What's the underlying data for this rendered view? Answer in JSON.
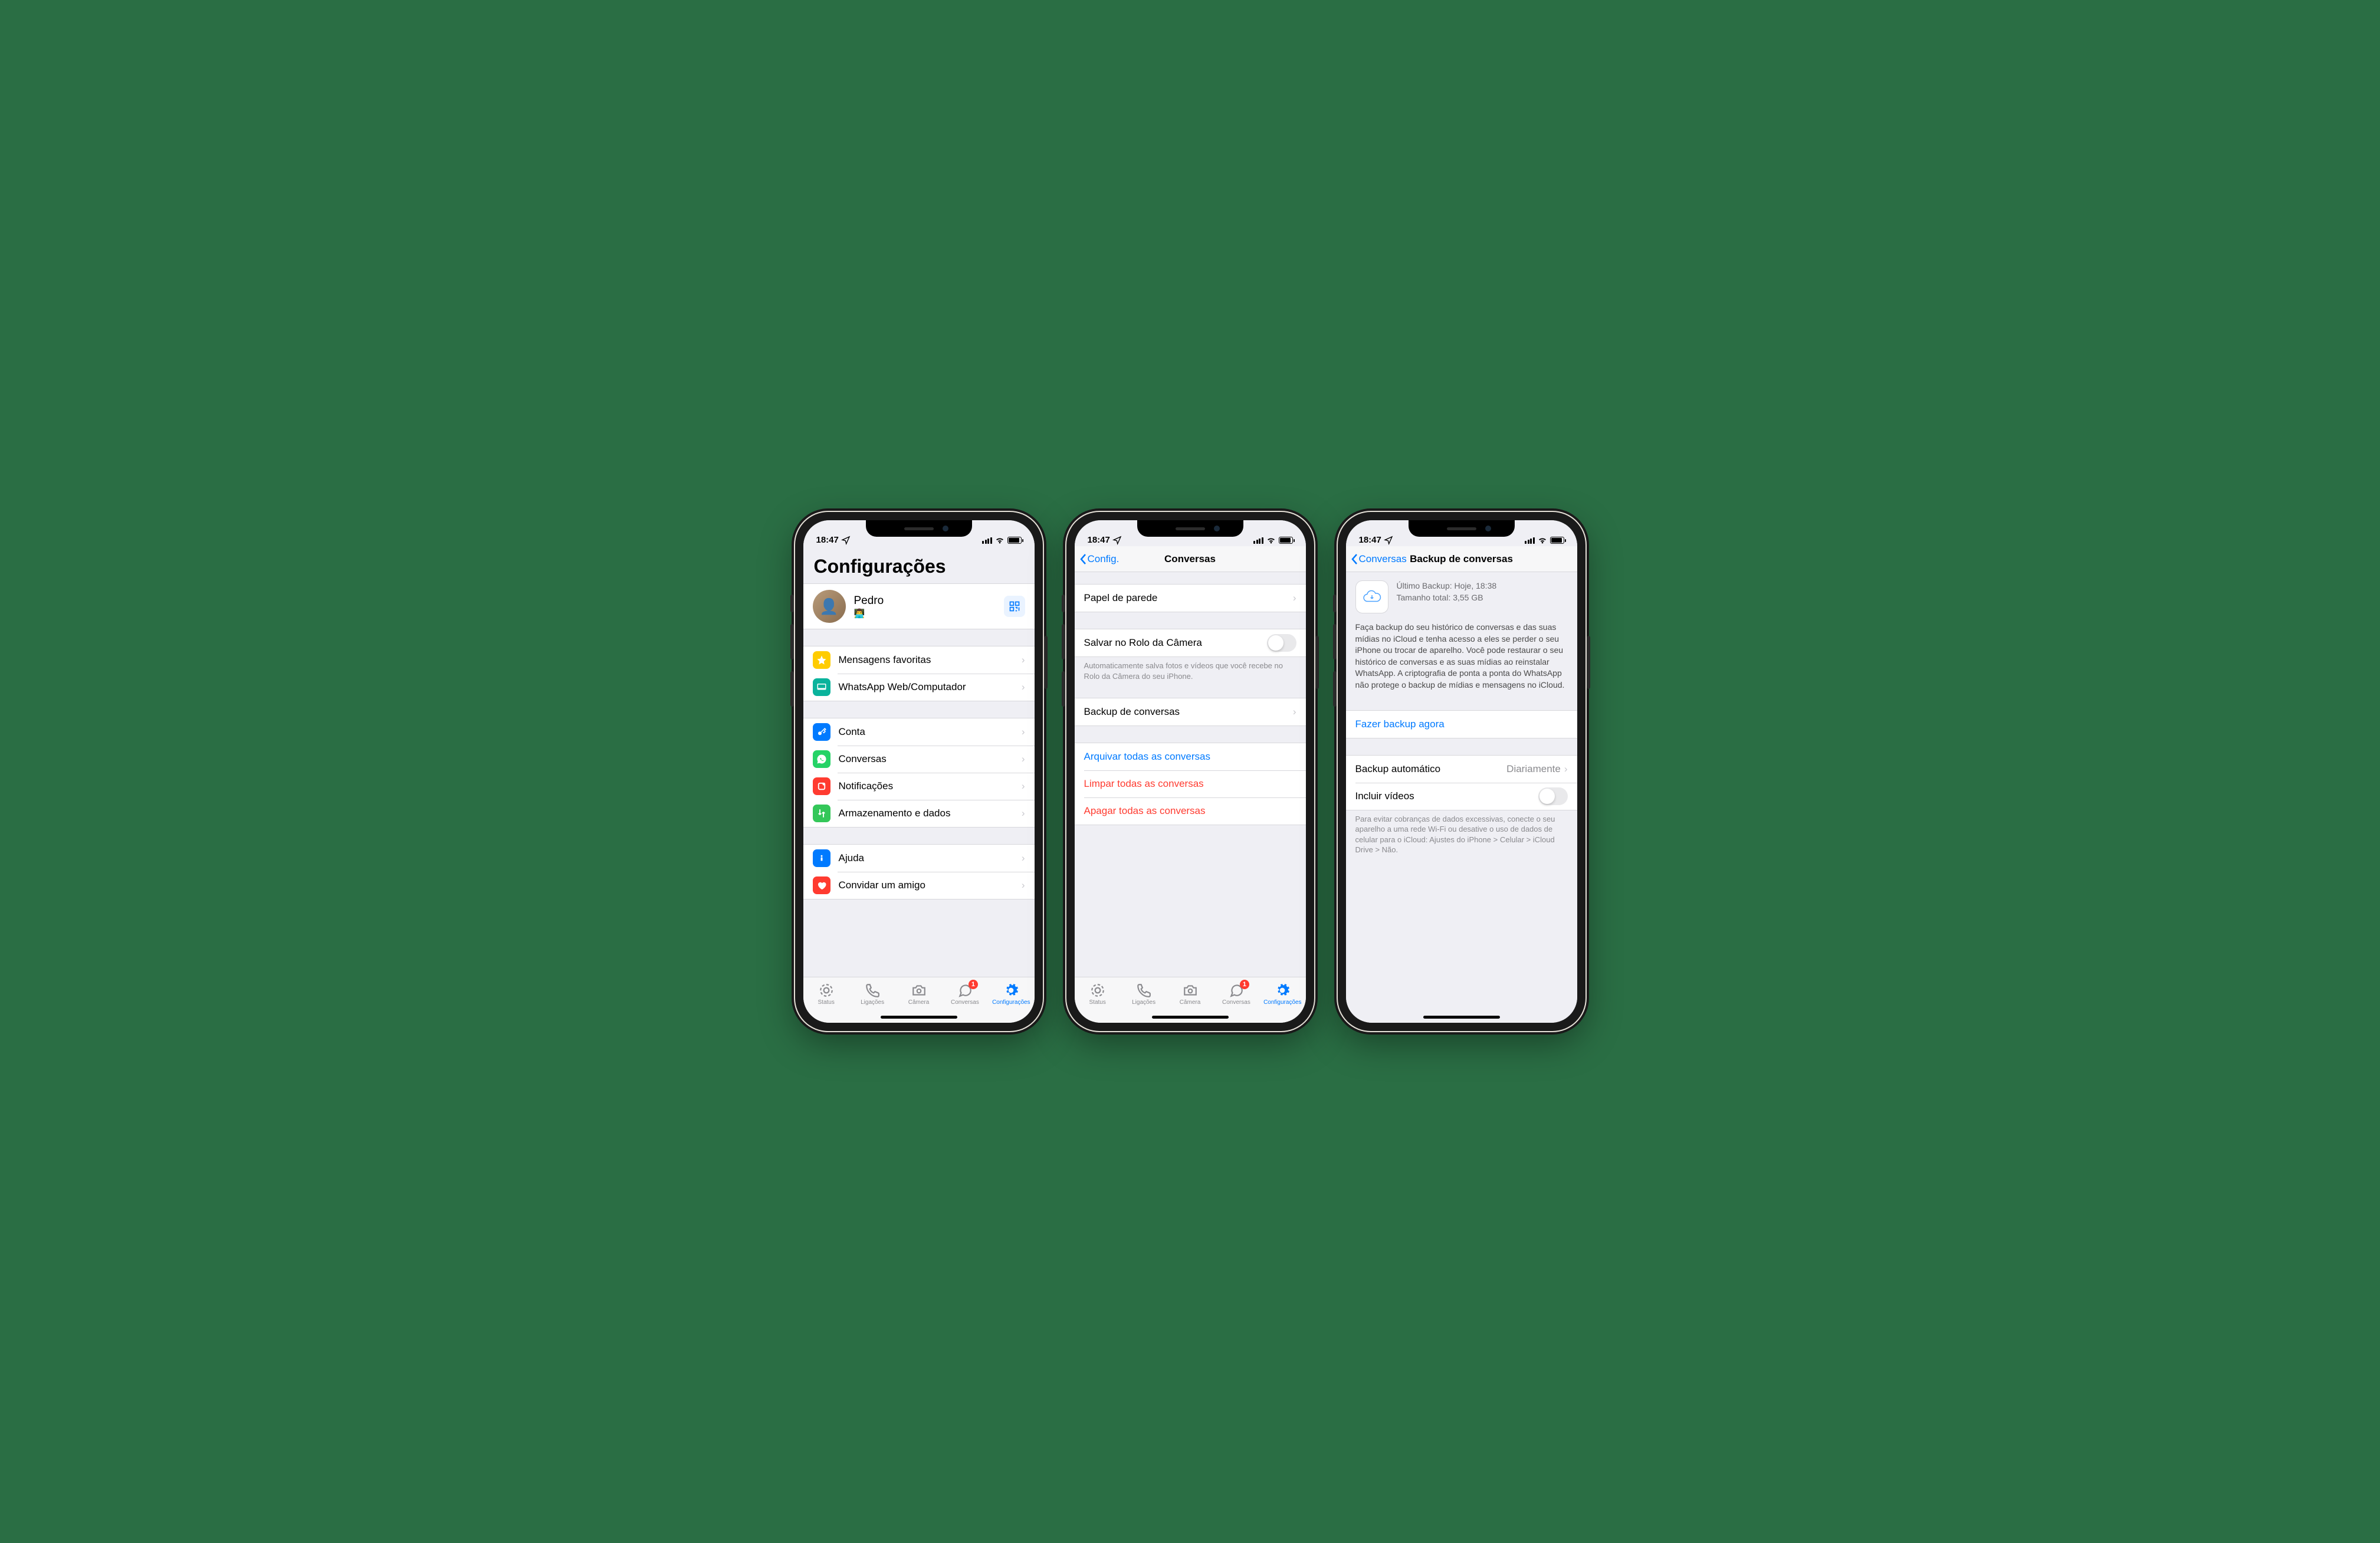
{
  "statusbar": {
    "time": "18:47"
  },
  "tabs": {
    "status": "Status",
    "calls": "Ligações",
    "camera": "Câmera",
    "chats": "Conversas",
    "settings": "Configurações",
    "chats_badge": "1"
  },
  "screen1": {
    "title": "Configurações",
    "profile": {
      "name": "Pedro",
      "status": "👨‍💻"
    },
    "items": {
      "starred": "Mensagens favoritas",
      "web": "WhatsApp Web/Computador",
      "account": "Conta",
      "chats": "Conversas",
      "notifications": "Notificações",
      "storage": "Armazenamento e dados",
      "help": "Ajuda",
      "invite": "Convidar um amigo"
    }
  },
  "screen2": {
    "back": "Config.",
    "title": "Conversas",
    "wallpaper": "Papel de parede",
    "save_camera": "Salvar no Rolo da Câmera",
    "save_camera_footer": "Automaticamente salva fotos e vídeos que você recebe no Rolo da Câmera do seu iPhone.",
    "backup": "Backup de conversas",
    "archive": "Arquivar todas as conversas",
    "clear": "Limpar todas as conversas",
    "delete": "Apagar todas as conversas"
  },
  "screen3": {
    "back": "Conversas",
    "title": "Backup de conversas",
    "last_backup": "Último Backup: Hoje, 18:38",
    "total_size": "Tamanho total: 3,55 GB",
    "description": "Faça backup do seu histórico de conversas e das suas mídias no iCloud e tenha acesso a eles se perder o seu iPhone ou trocar de aparelho. Você pode restaurar o seu histórico de conversas e as suas mídias ao reinstalar WhatsApp. A criptografia de ponta a ponta do WhatsApp não protege o backup de mídias e mensagens no iCloud.",
    "backup_now": "Fazer backup agora",
    "auto_backup": "Backup automático",
    "auto_backup_value": "Diariamente",
    "include_videos": "Incluir vídeos",
    "footer": "Para evitar cobranças de dados excessivas, conecte o seu aparelho a uma rede Wi-Fi ou desative o uso de dados de celular para o iCloud: Ajustes do iPhone > Celular > iCloud Drive > Não."
  }
}
